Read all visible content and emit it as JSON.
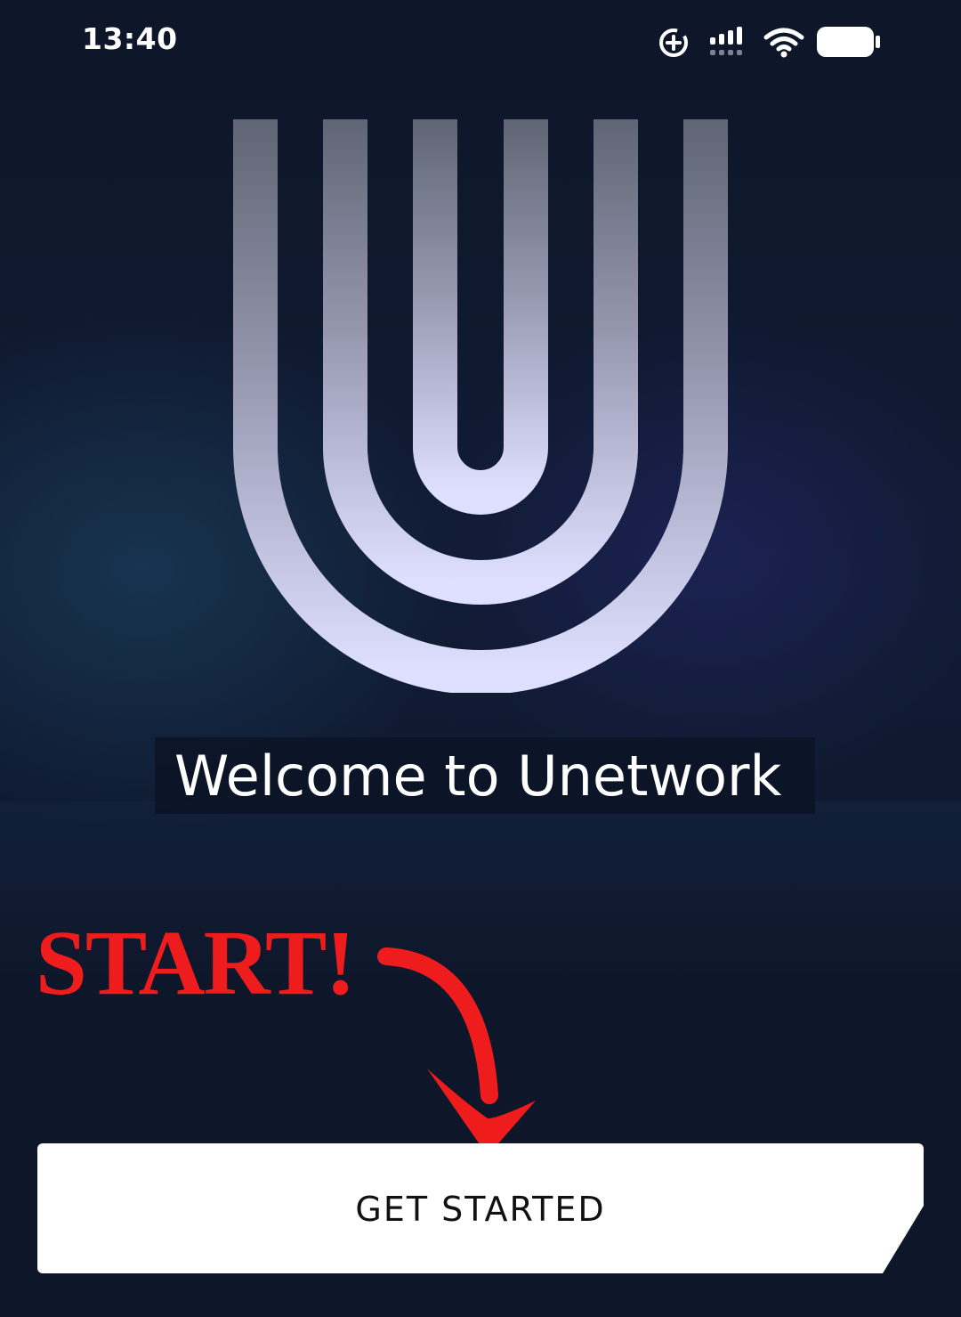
{
  "status_bar": {
    "time": "13:40",
    "icons": [
      "screen-rotation-lock-icon",
      "cellular-signal-icon",
      "wifi-icon",
      "battery-icon"
    ]
  },
  "logo": {
    "icon": "unetwork-logo-icon",
    "gradient_top": "#5f6574",
    "gradient_bottom": "#dfe0ff"
  },
  "welcome": {
    "title": "Welcome to Unetwork"
  },
  "annotation": {
    "label": "START!",
    "color": "#ee1c1c",
    "icon": "curved-arrow-down-icon"
  },
  "cta": {
    "label": "GET STARTED"
  },
  "colors": {
    "background": "#0e1629",
    "button": "#ffffff",
    "button_text": "#111111"
  }
}
